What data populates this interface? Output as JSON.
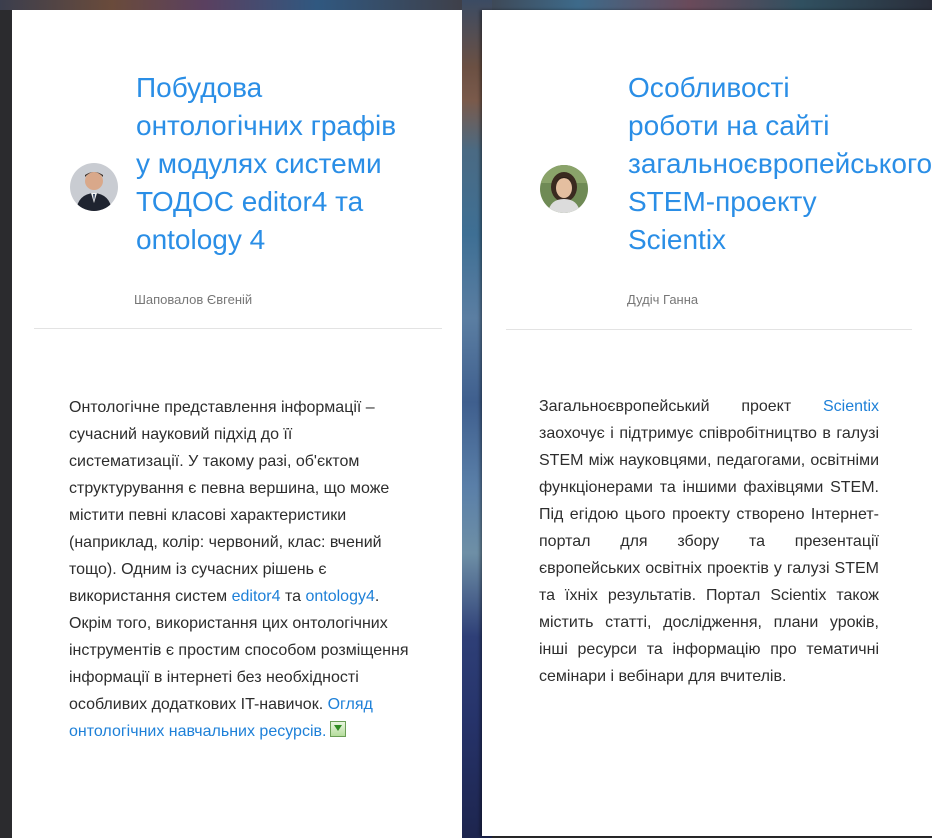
{
  "cards": [
    {
      "title_lines": [
        "Побудова",
        "онтологічних графів",
        "у модулях системи",
        "ТОДОС editor4 та",
        "ontology 4"
      ],
      "author": "Шаповалов Євгеній",
      "body": {
        "p1": "Онтологічне представлення інформації – сучасний науковий підхід до її систематизації. У такому разі, об'єктом структурування є певна вершина, що може містити певні класові характеристики (наприклад, колір: червоний, клас: вчений тощо). Одним із сучасних  рішень є використання систем ",
        "link1": "editor4",
        "p2": " та ",
        "link2": "ontology4",
        "p3": ". Окрім того, використання цих онтологічних інструментів є простим способом розміщення інформації в інтернеті без необхідності особливих додаткових IT-навичок. ",
        "link3": "Огляд онтологічних навчальних ресурсів."
      }
    },
    {
      "title_lines": [
        "Особливості",
        "роботи на сайті",
        "загальноєвропейського",
        "STEM-проекту",
        "Scientix"
      ],
      "author": "Дудіч Ганна",
      "body": {
        "p1": "Загальноєвропейський проект ",
        "link1": "Scientix",
        "p2": " заохочує і підтримує співробітництво в галузі STEM між науковцями, педагогами, освітніми функціонерами та іншими фахівцями STEM. Під егідою цього проекту створено Інтернет-портал для збору та презентації європейських освітніх проектів у галузі STEM та їхніх результатів. Портал Scientix також містить статті, дослідження, плани уроків, інші ресурси та інформацію про тематичні семінари і вебінари для вчителів."
      }
    }
  ],
  "colors": {
    "link": "#2a8ee6",
    "text": "#2d2d2d",
    "author": "#777777"
  }
}
